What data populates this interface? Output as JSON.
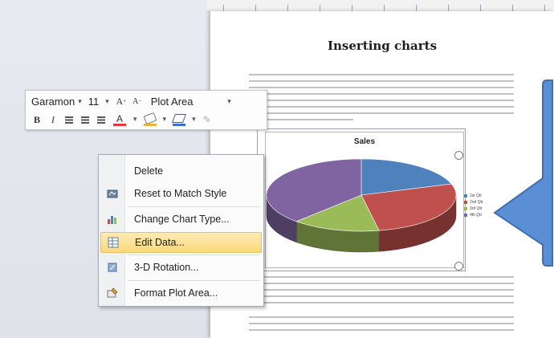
{
  "document": {
    "title": "Inserting charts"
  },
  "chart": {
    "title": "Sales",
    "legend_entries": [
      "1st Qtr",
      "2nd Qtr",
      "3rd Qtr",
      "4th Qtr"
    ],
    "colors": [
      "#4f81bd",
      "#c0504d",
      "#9bbb59",
      "#8064a2"
    ]
  },
  "chart_data": {
    "type": "pie",
    "title": "Sales",
    "categories": [
      "1st Qtr",
      "2nd Qtr",
      "3rd Qtr",
      "4th Qtr"
    ],
    "values": [
      20,
      27,
      15,
      38
    ]
  },
  "mini_toolbar": {
    "font_name": "Garamon",
    "font_size": "11",
    "grow_font": "A",
    "shrink_font": "A",
    "element_selector": "Plot Area",
    "bold": "B",
    "italic": "I",
    "font_color_letter": "A",
    "font_color": "#e23a3a",
    "fill_color": "#f2b23a",
    "outline_color": "#3d6fd0"
  },
  "context_menu": {
    "items": [
      {
        "label": "Delete",
        "icon": "none"
      },
      {
        "label": "Reset to Match Style",
        "icon": "reset-style-icon"
      },
      {
        "label": "Change Chart Type...",
        "icon": "change-chart-type-icon"
      },
      {
        "label": "Edit Data...",
        "icon": "edit-data-icon",
        "highlighted": true
      },
      {
        "label": "3-D Rotation...",
        "icon": "3d-rotation-icon"
      },
      {
        "label": "Format Plot Area...",
        "icon": "format-plot-area-icon"
      }
    ]
  }
}
